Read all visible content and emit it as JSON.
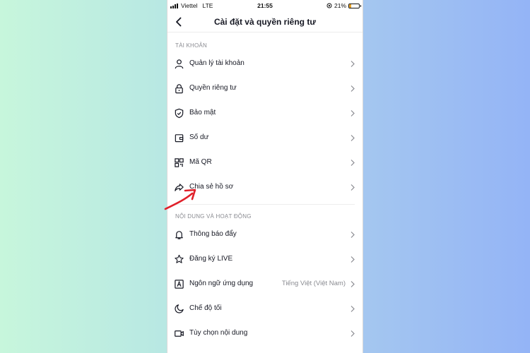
{
  "status_bar": {
    "carrier": "Viettel",
    "network": "LTE",
    "time": "21:55",
    "battery": "21%"
  },
  "header": {
    "title": "Cài đặt và quyền riêng tư"
  },
  "sections": [
    {
      "label": "TÀI KHOẢN",
      "items": [
        {
          "label": "Quản lý tài khoản",
          "icon": "person-icon"
        },
        {
          "label": "Quyền riêng tư",
          "icon": "lock-icon"
        },
        {
          "label": "Bảo mật",
          "icon": "shield-icon"
        },
        {
          "label": "Số dư",
          "icon": "wallet-icon"
        },
        {
          "label": "Mã QR",
          "icon": "qr-code-icon"
        },
        {
          "label": "Chia sẻ hồ sơ",
          "icon": "share-icon"
        }
      ]
    },
    {
      "label": "NỘI DUNG VÀ HOẠT ĐỘNG",
      "items": [
        {
          "label": "Thông báo đẩy",
          "icon": "bell-icon"
        },
        {
          "label": "Đăng ký LIVE",
          "icon": "live-star-icon"
        },
        {
          "label": "Ngôn ngữ ứng dụng",
          "icon": "language-icon",
          "value": "Tiếng Việt (Việt Nam)"
        },
        {
          "label": "Chế độ tối",
          "icon": "moon-icon"
        },
        {
          "label": "Tùy chọn nội dung",
          "icon": "video-icon"
        }
      ]
    }
  ],
  "colors": {
    "annotation_arrow": "#e0202a",
    "text_primary": "#161823",
    "text_secondary": "#8a8b91"
  }
}
